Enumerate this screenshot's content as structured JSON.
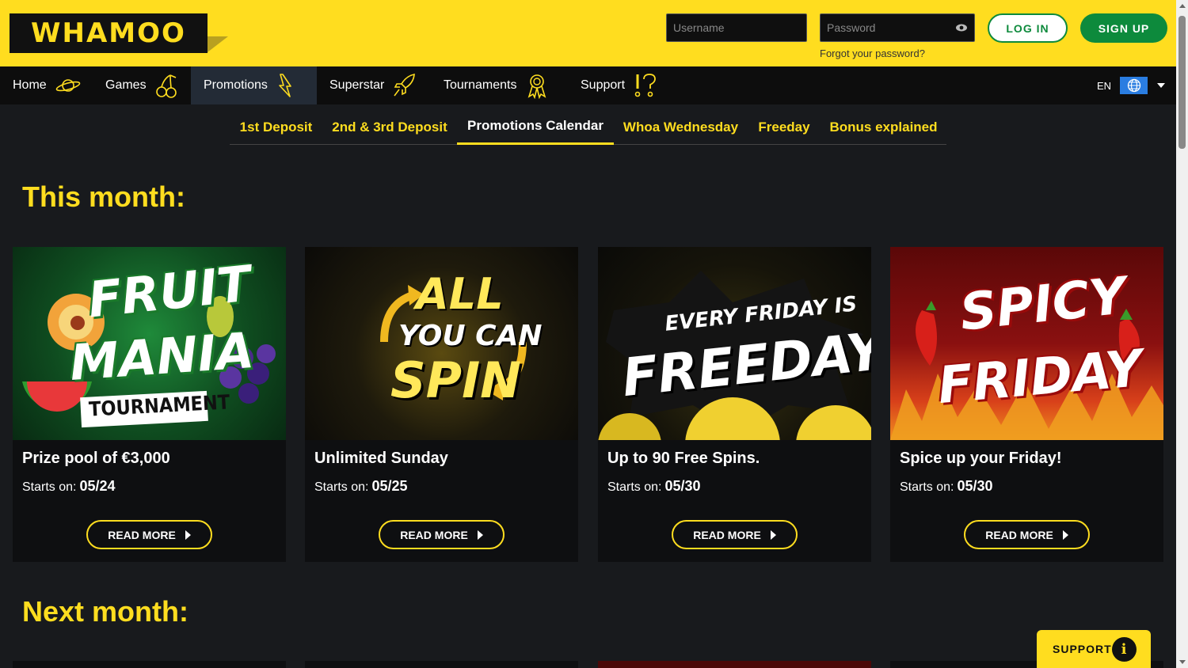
{
  "brand": {
    "logo_text": "WHAMOO"
  },
  "auth": {
    "username_placeholder": "Username",
    "password_placeholder": "Password",
    "forgot_label": "Forgot your password?",
    "login_label": "LOG IN",
    "signup_label": "SIGN UP"
  },
  "nav": {
    "items": [
      {
        "label": "Home",
        "icon": "planet-icon"
      },
      {
        "label": "Games",
        "icon": "cherries-icon"
      },
      {
        "label": "Promotions",
        "icon": "lightning-icon",
        "active": true
      },
      {
        "label": "Superstar",
        "icon": "rocket-icon"
      },
      {
        "label": "Tournaments",
        "icon": "medal-icon"
      },
      {
        "label": "Support",
        "icon": "exclamation-question-icon"
      }
    ],
    "language": "EN"
  },
  "subtabs": [
    {
      "label": "1st Deposit"
    },
    {
      "label": "2nd & 3rd Deposit"
    },
    {
      "label": "Promotions Calendar",
      "active": true
    },
    {
      "label": "Whoa Wednesday"
    },
    {
      "label": "Freeday"
    },
    {
      "label": "Bonus explained"
    }
  ],
  "sections": {
    "this_month": "This month:",
    "next_month": "Next month:"
  },
  "cards": [
    {
      "banner_line1": "FRUIT",
      "banner_line2": "MANIA",
      "banner_line3": "TOURNAMENT",
      "title": "Prize pool of €3,000",
      "starts_label": "Starts on:",
      "date": "05/24",
      "button": "READ MORE"
    },
    {
      "banner_line1": "ALL",
      "banner_line2": "YOU CAN",
      "banner_line3": "SPIN",
      "title": "Unlimited Sunday",
      "starts_label": "Starts on:",
      "date": "05/25",
      "button": "READ MORE"
    },
    {
      "banner_line1": "EVERY FRIDAY IS",
      "banner_line2": "FREEDAY",
      "title": "Up to 90 Free Spins.",
      "starts_label": "Starts on:",
      "date": "05/30",
      "button": "READ MORE"
    },
    {
      "banner_line1": "SPICY",
      "banner_line2": "FRIDAY",
      "title": "Spice up your Friday!",
      "starts_label": "Starts on:",
      "date": "05/30",
      "button": "READ MORE"
    }
  ],
  "support_widget": {
    "label": "SUPPORT",
    "icon": "info-icon"
  },
  "colors": {
    "accent": "#ffdd1f",
    "green": "#0d8a3c",
    "background": "#181a1d"
  }
}
